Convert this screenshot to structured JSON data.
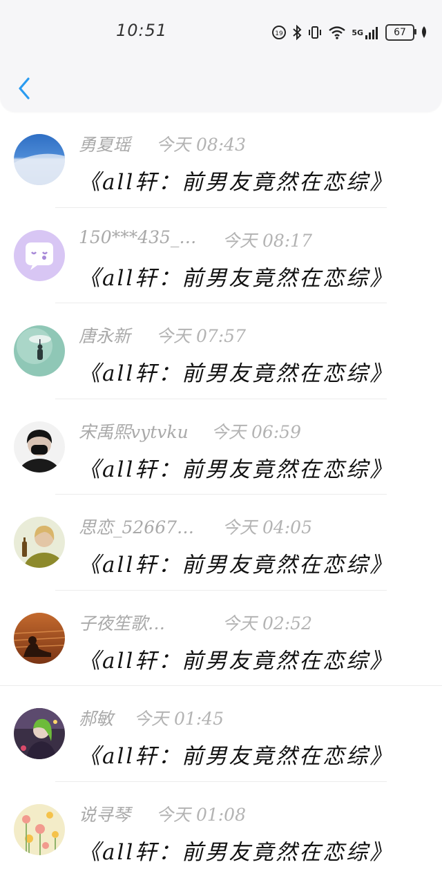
{
  "status_bar": {
    "time": "10:51",
    "network": "5G",
    "battery": "67"
  },
  "header": {
    "back_icon": "chevron-left-icon",
    "accent_color": "#2a9bf0"
  },
  "messages": [
    {
      "name": "勇夏瑶",
      "time": "今天 08:43",
      "text": "《all轩：前男友竟然在恋综》"
    },
    {
      "name": "150***435_…",
      "time": "今天 08:17",
      "text": "《all轩：前男友竟然在恋综》"
    },
    {
      "name": "唐永新",
      "time": "今天 07:57",
      "text": "《all轩：前男友竟然在恋综》"
    },
    {
      "name": "宋禹熙vytvku",
      "time": "今天 06:59",
      "text": "《all轩：前男友竟然在恋综》"
    },
    {
      "name": "思恋_52667…",
      "time": "今天 04:05",
      "text": "《all轩：前男友竟然在恋综》"
    },
    {
      "name": "子夜笙歌…",
      "time": "今天 02:52",
      "text": "《all轩：前男友竟然在恋综》"
    },
    {
      "name": "郝敏",
      "time": "今天 01:45",
      "text": "《all轩：前男友竟然在恋综》"
    },
    {
      "name": "说寻琴",
      "time": "今天 01:08",
      "text": "《all轩：前男友竟然在恋综》"
    }
  ]
}
